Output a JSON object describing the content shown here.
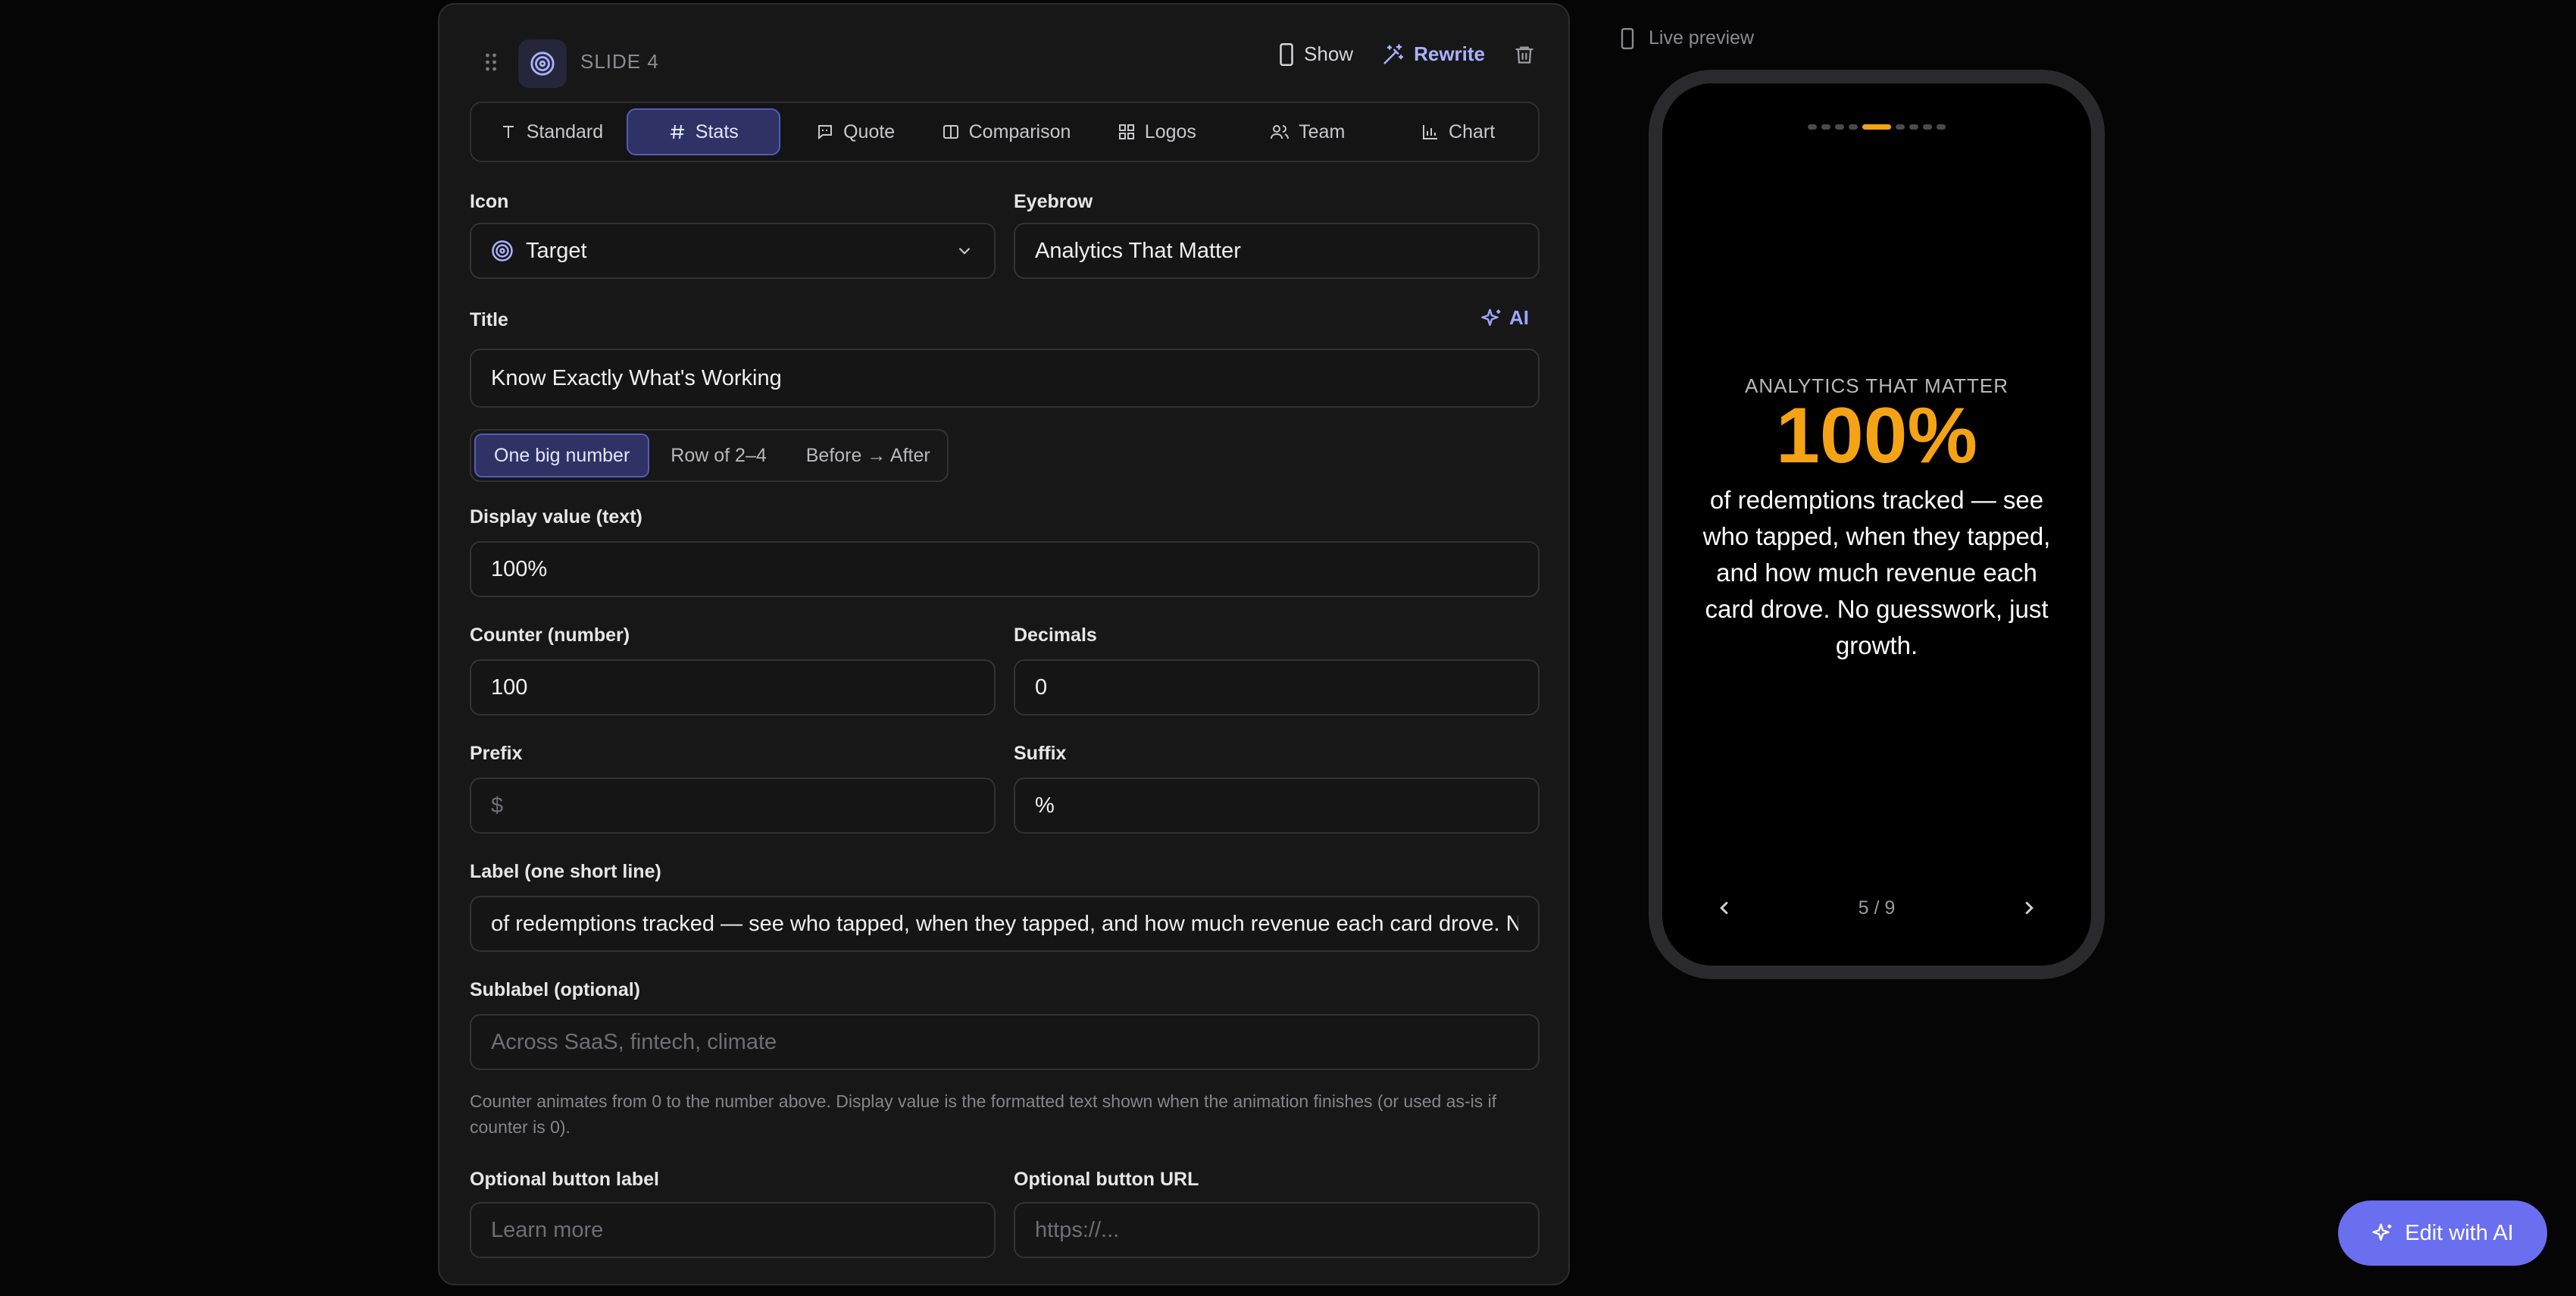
{
  "header": {
    "slide_label": "SLIDE 4",
    "show_label": "Show",
    "rewrite_label": "Rewrite"
  },
  "type_tabs": [
    {
      "label": "Standard",
      "icon": "text-icon"
    },
    {
      "label": "Stats",
      "icon": "hash-icon",
      "active": true
    },
    {
      "label": "Quote",
      "icon": "quote-icon"
    },
    {
      "label": "Comparison",
      "icon": "columns-icon"
    },
    {
      "label": "Logos",
      "icon": "grid-icon"
    },
    {
      "label": "Team",
      "icon": "users-icon"
    },
    {
      "label": "Chart",
      "icon": "bar-chart-icon"
    }
  ],
  "form": {
    "icon_label": "Icon",
    "icon_value": "Target",
    "eyebrow_label": "Eyebrow",
    "eyebrow_value": "Analytics That Matter",
    "title_label": "Title",
    "ai_label": "AI",
    "title_value": "Know Exactly What's Working",
    "modes": [
      "One big number",
      "Row of 2–4",
      "Before → After"
    ],
    "display_label": "Display value (text)",
    "display_value": "100%",
    "counter_label": "Counter (number)",
    "counter_value": "100",
    "decimals_label": "Decimals",
    "decimals_value": "0",
    "prefix_label": "Prefix",
    "prefix_placeholder": "$",
    "suffix_label": "Suffix",
    "suffix_value": "%",
    "label_label": "Label (one short line)",
    "label_value": "of redemptions tracked — see who tapped, when they tapped, and how much revenue each card drove. N",
    "sublabel_label": "Sublabel (optional)",
    "sublabel_placeholder": "Across SaaS, fintech, climate",
    "hint": "Counter animates from 0 to the number above. Display value is the formatted text shown when the animation finishes (or used as-is if counter is 0).",
    "button_label_label": "Optional button label",
    "button_label_placeholder": "Learn more",
    "button_url_label": "Optional button URL",
    "button_url_placeholder": "https://..."
  },
  "preview": {
    "header": "Live preview",
    "eyebrow": "ANALYTICS THAT MATTER",
    "value": "100%",
    "label": "of redemptions tracked — see who tapped, when they tapped, and how much revenue each card drove. No guesswork, just growth.",
    "page": "5 / 9",
    "dot_count": 9,
    "active_dot": 5
  },
  "fab": {
    "label": "Edit with AI"
  },
  "colors": {
    "accent": "#f5a316",
    "brand": "#6a6ff0",
    "active_tab": "#2e3264"
  }
}
